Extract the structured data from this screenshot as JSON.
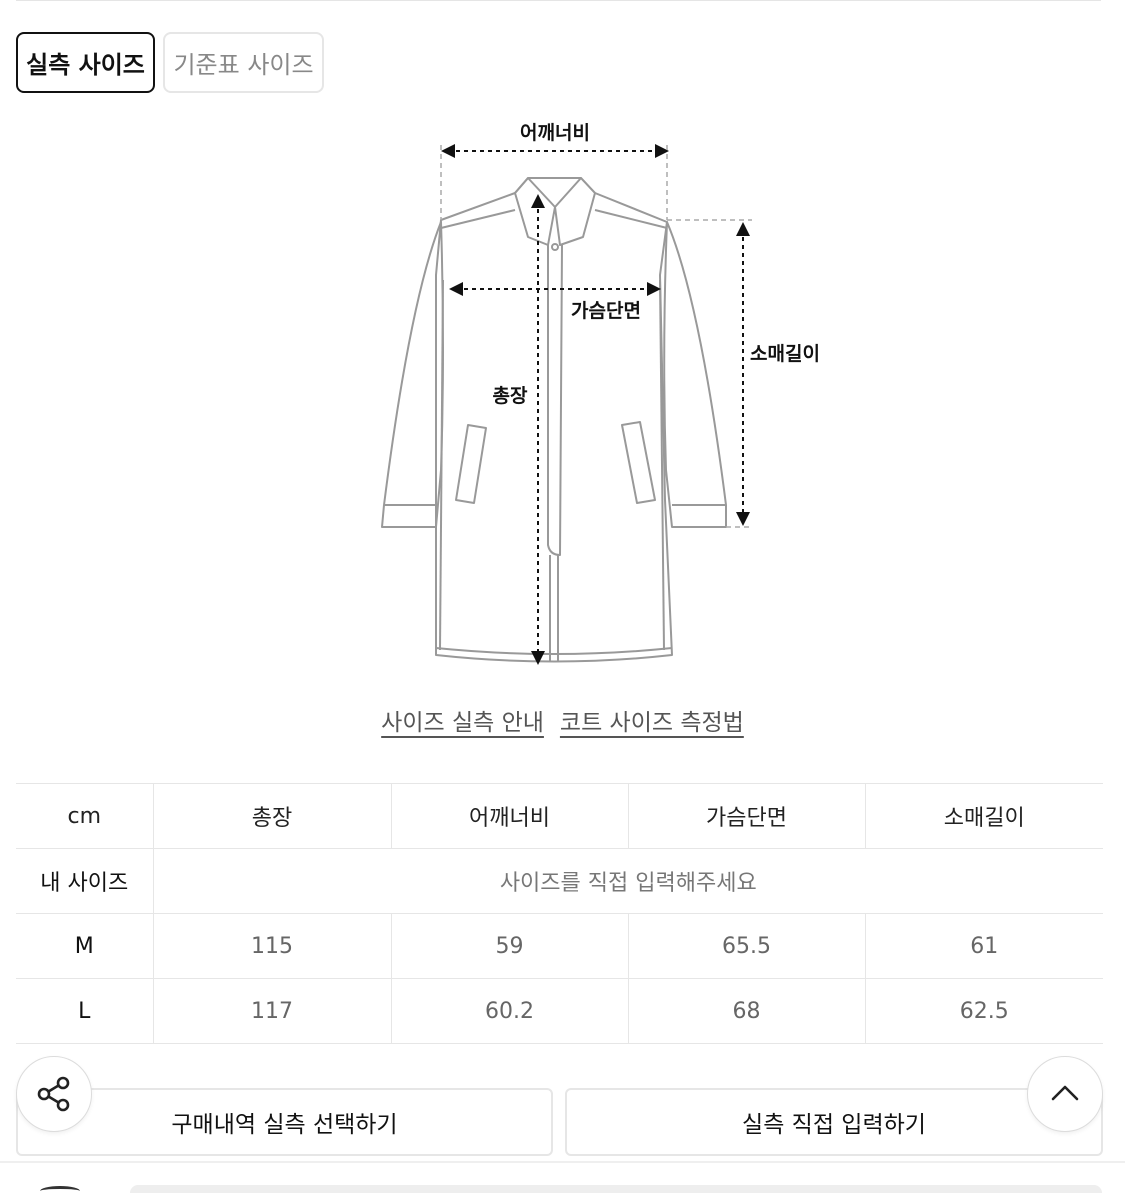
{
  "tabs": {
    "actual": "실측 사이즈",
    "standard": "기준표 사이즈"
  },
  "diagram": {
    "shoulder": "어깨너비",
    "chest": "가슴단면",
    "sleeve": "소매길이",
    "length": "총장"
  },
  "links": {
    "guide": "사이즈 실측 안내",
    "method": "코트 사이즈 측정법"
  },
  "table": {
    "headers": [
      "cm",
      "총장",
      "어깨너비",
      "가슴단면",
      "소매길이"
    ],
    "my_size_label": "내 사이즈",
    "my_size_placeholder": "사이즈를 직접 입력해주세요",
    "rows": [
      {
        "size": "M",
        "values": [
          "115",
          "59",
          "65.5",
          "61"
        ]
      },
      {
        "size": "L",
        "values": [
          "117",
          "60.2",
          "68",
          "62.5"
        ]
      }
    ]
  },
  "buttons": {
    "history": "구매내역 실측 선택하기",
    "direct": "실측 직접 입력하기"
  },
  "icons": {
    "share": "share-icon",
    "top": "chevron-up-icon"
  }
}
